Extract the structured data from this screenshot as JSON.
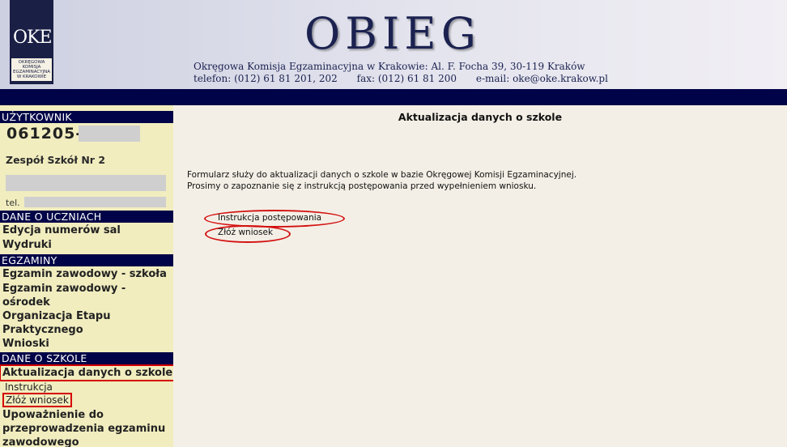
{
  "header": {
    "logo_mark": "OKE",
    "logo_caption": [
      "OKRĘGOWA",
      "KOMISJA",
      "EGZAMINACYJNA",
      "W KRAKOWIE"
    ],
    "brand": "OBIEG",
    "address": "Okręgowa Komisja Egzaminacyjna w Krakowie: Al. F. Focha 39, 30-119 Kraków",
    "phone": "telefon: (012) 61 81 201, 202",
    "fax": "fax: (012) 61 81 200",
    "email": "e-mail: oke@oke.krakow.pl"
  },
  "sidebar": {
    "user_heading": "UŻYTKOWNIK",
    "user_id": "061205-",
    "school_name": "Zespół Szkół Nr 2",
    "tel_label": "tel.",
    "students_heading": "DANE O UCZNIACH",
    "students_items": [
      "Edycja numerów sal",
      "Wydruki"
    ],
    "exams_heading": "EGZAMINY",
    "exams_items": [
      "Egzamin zawodowy - szkoła",
      "Egzamin zawodowy - ośrodek",
      "Organizacja Etapu Praktycznego",
      "Wnioski"
    ],
    "school_heading": "DANE O SZKOLE",
    "school_active": "Aktualizacja danych o szkole",
    "school_sub": [
      "Instrukcja",
      "Złóż wniosek"
    ],
    "school_more": "Upoważnienie do przeprowadzenia egzaminu zawodowego"
  },
  "main": {
    "title": "Aktualizacja danych o szkole",
    "desc_line1": "Formularz służy do aktualizacji danych o szkole w bazie Okręgowej Komisji Egzaminacyjnej.",
    "desc_line2": "Prosimy o zapoznanie się z instrukcją postępowania przed wypełnieniem wniosku.",
    "link_instructions": "Instrukcja postępowania",
    "link_submit": "Złóż wniosek"
  },
  "colors": {
    "navy": "#000347",
    "sidebar_bg": "#f1edbf",
    "page_bg": "#f3efe6",
    "highlight_red": "#d40000"
  }
}
